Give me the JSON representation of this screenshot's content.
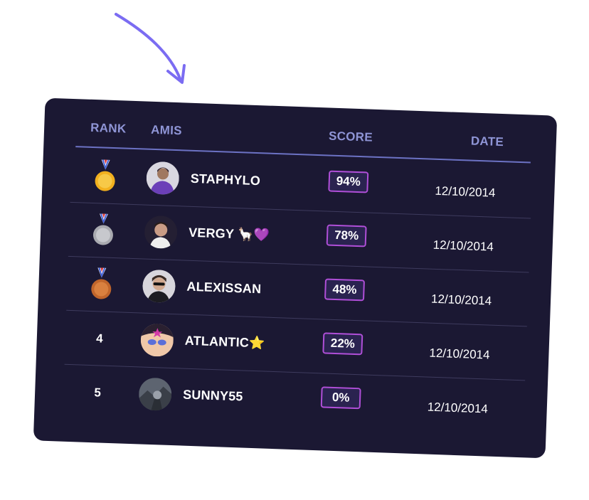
{
  "leaderboard": {
    "headers": {
      "rank": "RANK",
      "friends": "AMIS",
      "score": "SCORE",
      "date": "DATE"
    },
    "rows": [
      {
        "rank": "1",
        "medal": "gold-medal-icon",
        "name": "STAPHYLO",
        "score": "94%",
        "date": "12/10/2014"
      },
      {
        "rank": "2",
        "medal": "silver-medal-icon",
        "name": "VERGY 🦙💜",
        "score": "78%",
        "date": "12/10/2014"
      },
      {
        "rank": "3",
        "medal": "bronze-medal-icon",
        "name": "ALEXISSAN",
        "score": "48%",
        "date": "12/10/2014"
      },
      {
        "rank": "4",
        "medal": "",
        "name": "ATLANTIC⭐",
        "score": "22%",
        "date": "12/10/2014"
      },
      {
        "rank": "5",
        "medal": "",
        "name": "SUNNY55",
        "score": "0%",
        "date": "12/10/2014"
      }
    ]
  },
  "colors": {
    "card_bg": "#1b1833",
    "header_text": "#8f95d6",
    "accent_arrow": "#7b6cf2",
    "badge_border": "#b04fd8",
    "gold": "#f2b01e",
    "silver": "#a9aab0",
    "bronze": "#c0652b"
  }
}
